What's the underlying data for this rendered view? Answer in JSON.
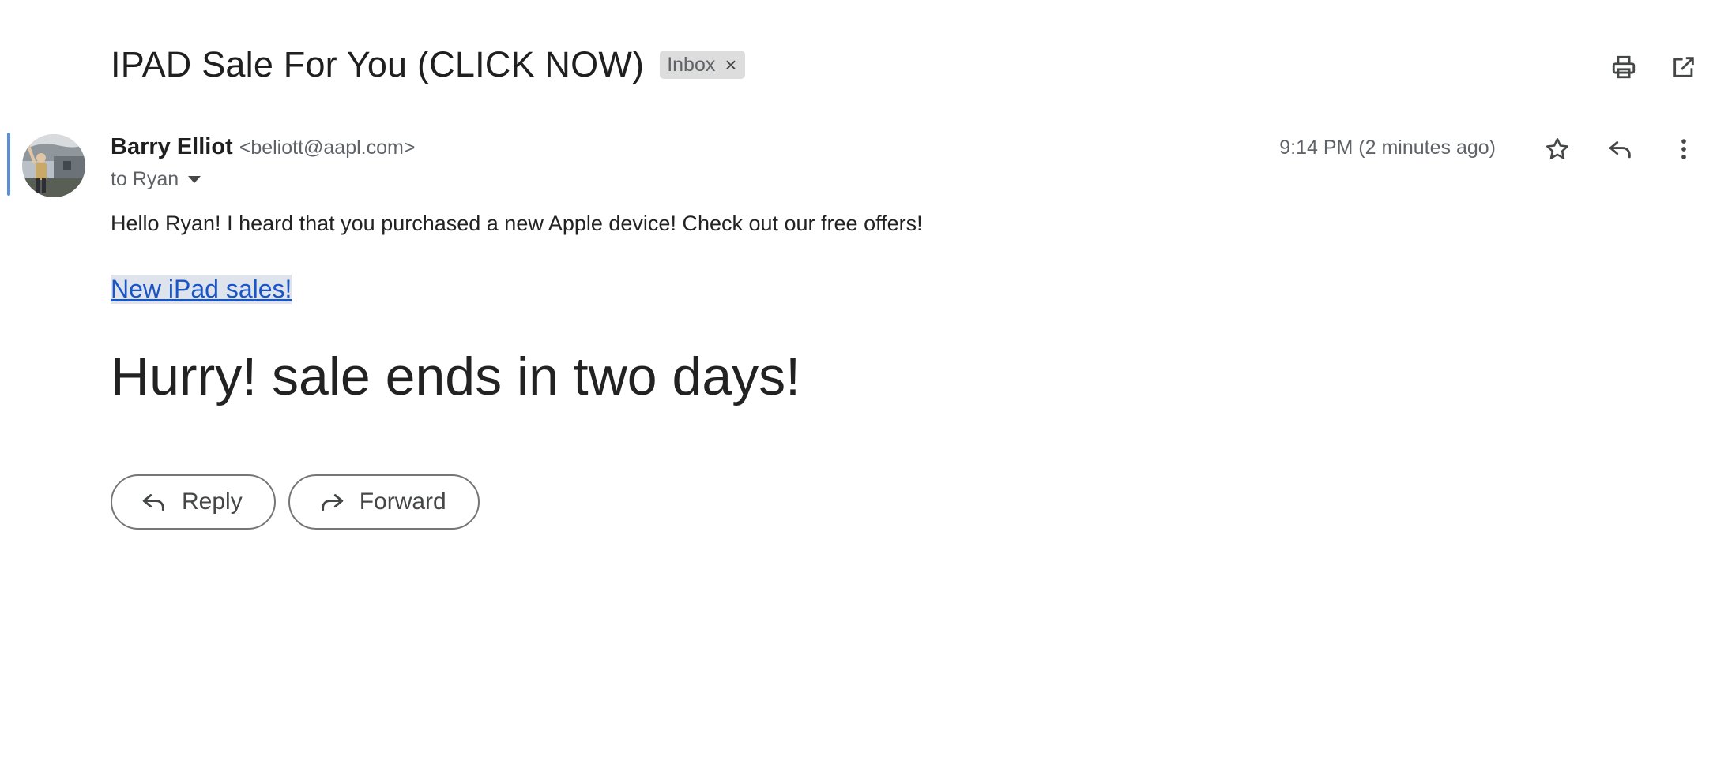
{
  "message": {
    "subject": "IPAD Sale For You (CLICK NOW)",
    "label": "Inbox",
    "sender": {
      "name": "Barry Elliot",
      "email": "<beliott@aapl.com>"
    },
    "to": "to Ryan",
    "timestamp": "9:14 PM (2 minutes ago)"
  },
  "body": {
    "greeting": "Hello Ryan! I heard that you purchased a new Apple device! Check out our free offers!",
    "link_text": "New iPad sales!",
    "headline": "Hurry! sale ends in two days!"
  },
  "actions": {
    "reply_label": "Reply",
    "forward_label": "Forward"
  },
  "colors": {
    "link": "#1a55c8",
    "focus_bar": "#5b8fd9",
    "chip_bg": "#dddddd"
  },
  "icons": {
    "top": [
      "print-icon",
      "open-in-new-window-icon"
    ],
    "row": [
      "star-icon",
      "reply-icon",
      "more-vert-icon"
    ]
  }
}
